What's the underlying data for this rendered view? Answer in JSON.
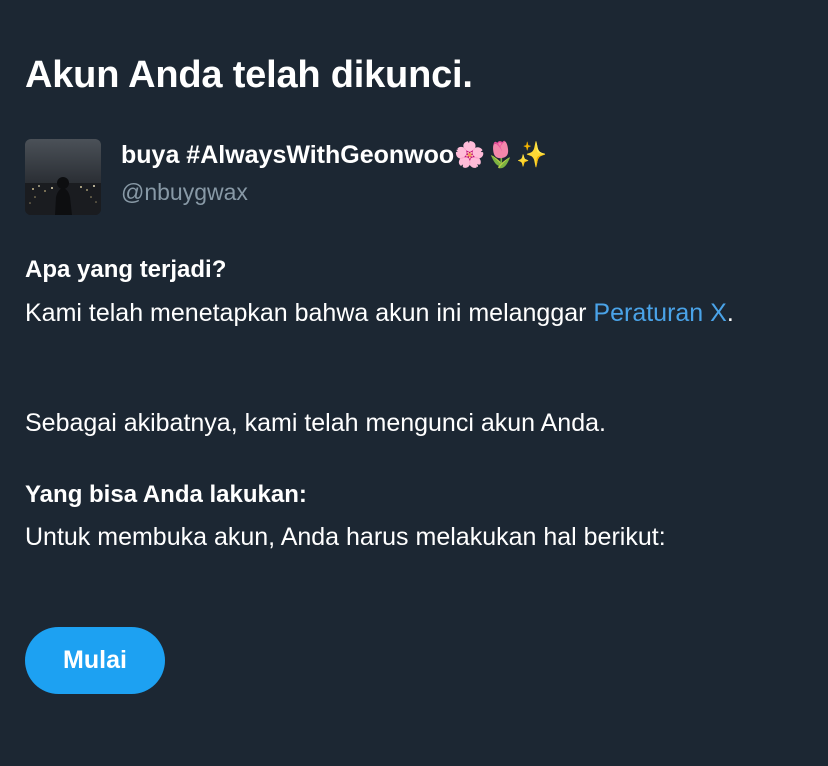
{
  "page": {
    "title": "Akun Anda telah dikunci."
  },
  "account": {
    "display_name": "buya #AlwaysWithGeonwoo🌸🌷✨",
    "handle": "@nbuygwax",
    "avatar_icon": "night-city-photo"
  },
  "what_happened": {
    "heading": "Apa yang terjadi?",
    "text_before_link": "Kami telah menetapkan bahwa akun ini melanggar ",
    "link_text": "Peraturan X",
    "text_after_link": ".",
    "consequence": "Sebagai akibatnya, kami telah mengunci akun Anda."
  },
  "what_you_can_do": {
    "heading": "Yang bisa Anda lakukan:",
    "text": "Untuk membuka akun, Anda harus melakukan hal berikut:"
  },
  "actions": {
    "start_label": "Mulai"
  },
  "colors": {
    "background": "#1c2733",
    "text": "#ffffff",
    "muted": "#8899a6",
    "link": "#4aa3e8",
    "button": "#1da1f2"
  }
}
